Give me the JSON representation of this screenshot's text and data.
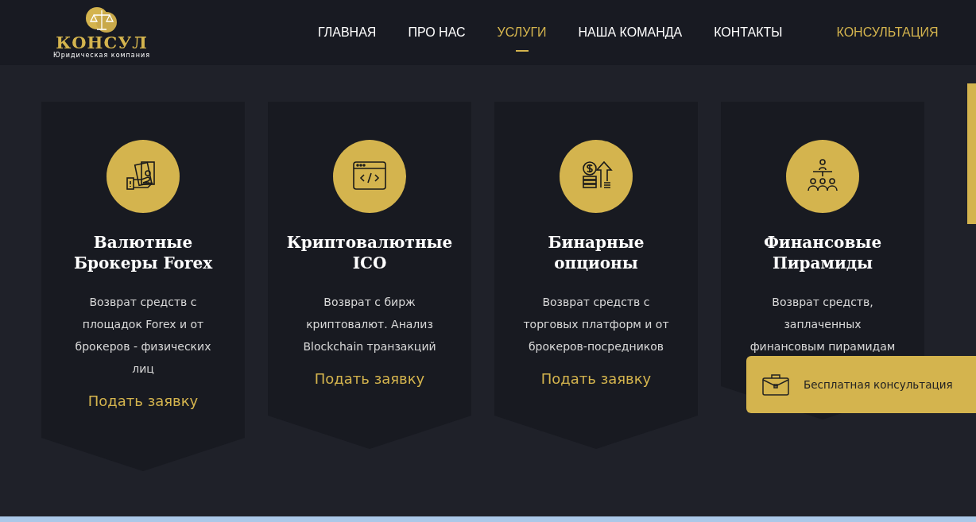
{
  "logo": {
    "name": "КОНСУЛ",
    "tagline": "Юридическая компания"
  },
  "nav": [
    {
      "label": "ГЛАВНАЯ",
      "selected": false
    },
    {
      "label": "ПРО НАС",
      "selected": false
    },
    {
      "label": "УСЛУГИ",
      "selected": true
    },
    {
      "label": "НАША КОМАНДА",
      "selected": false
    },
    {
      "label": "КОНТАКТЫ",
      "selected": false
    }
  ],
  "header_cta": "КОНСУЛЬТАЦИЯ",
  "services": [
    {
      "kind": "money",
      "title": "Валютные Брокеры Forex",
      "text": "Возврат средств с площадок Forex и от брокеров - физических лиц",
      "link": "Подать заявку"
    },
    {
      "kind": "code",
      "title": "Криптовалютные ICO",
      "text": "Возврат с бирж криптовалют. Анализ Blockchain транзакций",
      "link": "Подать заявку"
    },
    {
      "kind": "growth",
      "title": "Бинарные опционы",
      "text": "Возврат средств с торговых платформ и от брокеров-посредников",
      "link": "Подать заявку"
    },
    {
      "kind": "people",
      "title": "Финансовые Пирамиды",
      "text": "Возврат средств, заплаченных финансовым пирамидам"
    }
  ],
  "float_button": "Бесплатная консультация"
}
